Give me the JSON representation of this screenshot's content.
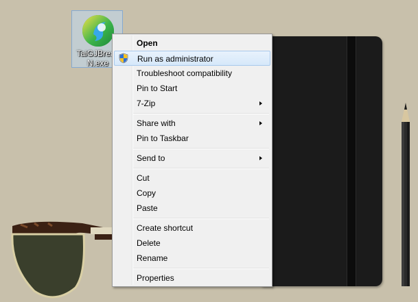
{
  "desktop_icon": {
    "label_line1": "TaiGJBreak",
    "label_line2": "N.exe",
    "icon": "taig-app-icon"
  },
  "context_menu": {
    "items": [
      {
        "label": "Open",
        "bold": true
      },
      {
        "label": "Run as administrator",
        "icon": "uac-shield-icon",
        "highlighted": true
      },
      {
        "label": "Troubleshoot compatibility"
      },
      {
        "label": "Pin to Start"
      },
      {
        "label": "7-Zip",
        "submenu": true
      },
      {
        "label": "Share with",
        "submenu": true
      },
      {
        "label": "Pin to Taskbar"
      },
      {
        "label": "Send to",
        "submenu": true
      },
      {
        "label": "Cut"
      },
      {
        "label": "Copy"
      },
      {
        "label": "Paste"
      },
      {
        "label": "Create shortcut"
      },
      {
        "label": "Delete"
      },
      {
        "label": "Rename"
      },
      {
        "label": "Properties"
      }
    ]
  },
  "colors": {
    "desktop_background": "#c8c0ab",
    "menu_background": "#f0f0f0",
    "highlight": "#d6e8fa",
    "notebook": "#1b1b1b"
  }
}
